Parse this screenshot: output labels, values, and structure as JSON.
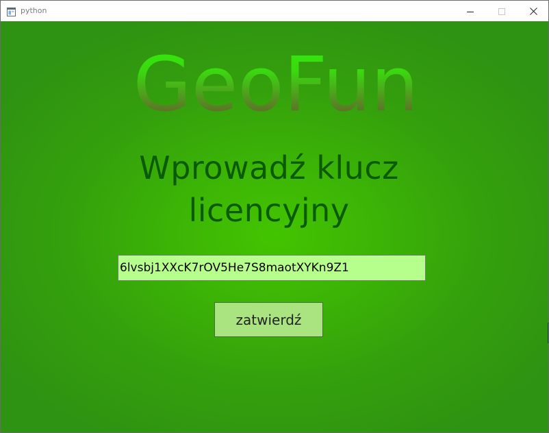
{
  "window": {
    "title": "python",
    "app_icon": "window-app-icon",
    "controls": [
      "minimize-icon",
      "maximize-icon",
      "close-icon"
    ]
  },
  "main": {
    "logo_text": "GeoFun",
    "heading_line1": "Wprowadź klucz",
    "heading_line2": "licencyjny",
    "license_key_value": "6lvsbj1XXcK7rOV5He7S8maotXYKn9Z1",
    "submit_label": "zatwierdź"
  },
  "colors": {
    "background_center": "#43c400",
    "background_edge": "#2e9212",
    "logo_top": "#2ef00a",
    "logo_bottom": "#6b4a32",
    "heading": "#0b5a05",
    "input_background": "#b7ff8c",
    "button_background": "#a9e480"
  }
}
